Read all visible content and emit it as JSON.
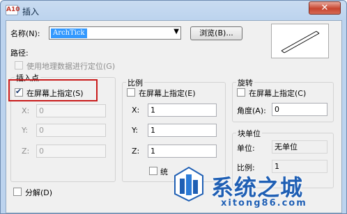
{
  "window": {
    "title": "插入",
    "app_icon_text": "A10",
    "close_symbol": "✕"
  },
  "name_row": {
    "label": "名称(N):",
    "value": "ArchTick",
    "browse_label": "浏览(B)..."
  },
  "path": {
    "label": "路径:",
    "geo_label": "使用地理数据进行定位(G)",
    "geo_checked": false
  },
  "insertion_point": {
    "title": "插入点",
    "onscreen_label": "在屏幕上指定(S)",
    "onscreen_checked": true,
    "x_label": "X:",
    "x_value": "0",
    "y_label": "Y:",
    "y_value": "0",
    "z_label": "Z:",
    "z_value": "0"
  },
  "scale": {
    "title": "比例",
    "onscreen_label": "在屏幕上指定(E)",
    "onscreen_checked": false,
    "x_label": "X:",
    "x_value": "1",
    "y_label": "Y:",
    "y_value": "1",
    "z_label": "Z:",
    "z_value": "1",
    "uniform_label": "统"
  },
  "rotation": {
    "title": "旋转",
    "onscreen_label": "在屏幕上指定(C)",
    "onscreen_checked": false,
    "angle_label": "角度(A):",
    "angle_value": "0"
  },
  "block_unit": {
    "title": "块单位",
    "unit_label": "单位:",
    "unit_value": "无单位",
    "ratio_label": "比例:",
    "ratio_value": "1"
  },
  "explode": {
    "label": "分解(D)",
    "checked": false
  },
  "watermark": {
    "title": "系统之城",
    "url": "xitong86.com"
  },
  "colors": {
    "accent_red": "#c91a1a",
    "selection": "#3399ff",
    "watermark_blue": "#1f5fb4"
  }
}
